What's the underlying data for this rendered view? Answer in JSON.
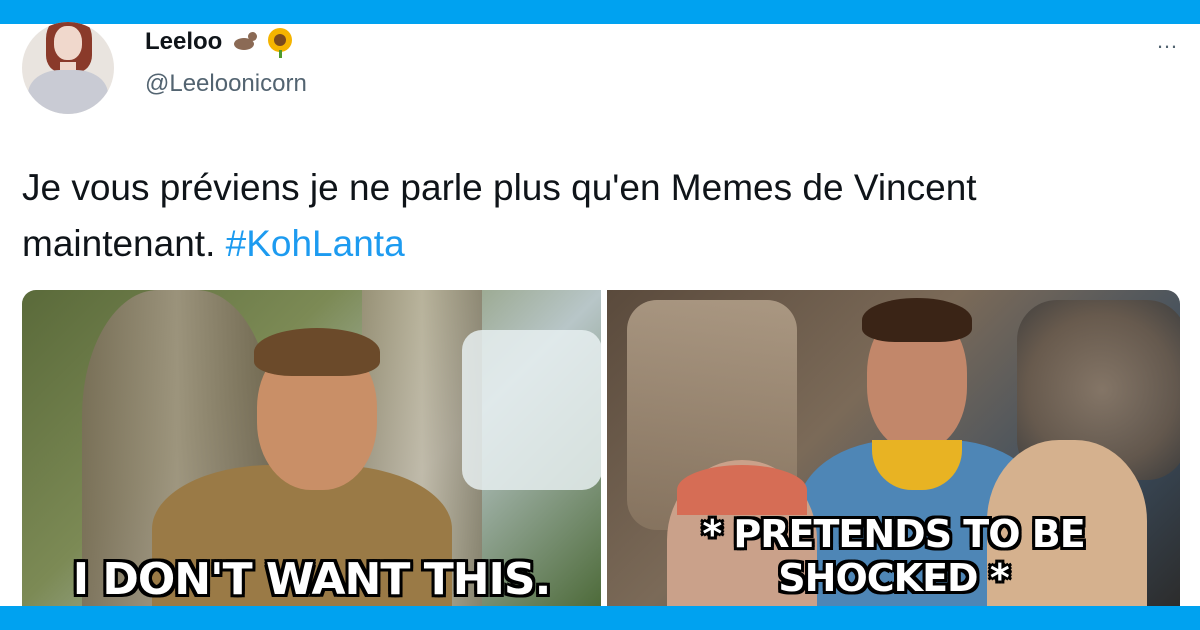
{
  "theme": {
    "accent": "#00a2f0",
    "link": "#1d9bf0",
    "text": "#0f1419",
    "muted": "#536471"
  },
  "header": {
    "display_name": "Leeloo",
    "name_emojis": [
      "otter-emoji",
      "sunflower-emoji"
    ],
    "handle": "@Leeloonicorn",
    "more_icon": "…"
  },
  "tweet": {
    "text_main": "Je vous préviens je ne parle plus qu'en Memes de Vincent maintenant.",
    "hashtag": "#KohLanta"
  },
  "media": {
    "left_caption": "I DON'T WANT THIS.",
    "right_caption": "* PRETENDS TO BE SHOCKED *"
  }
}
